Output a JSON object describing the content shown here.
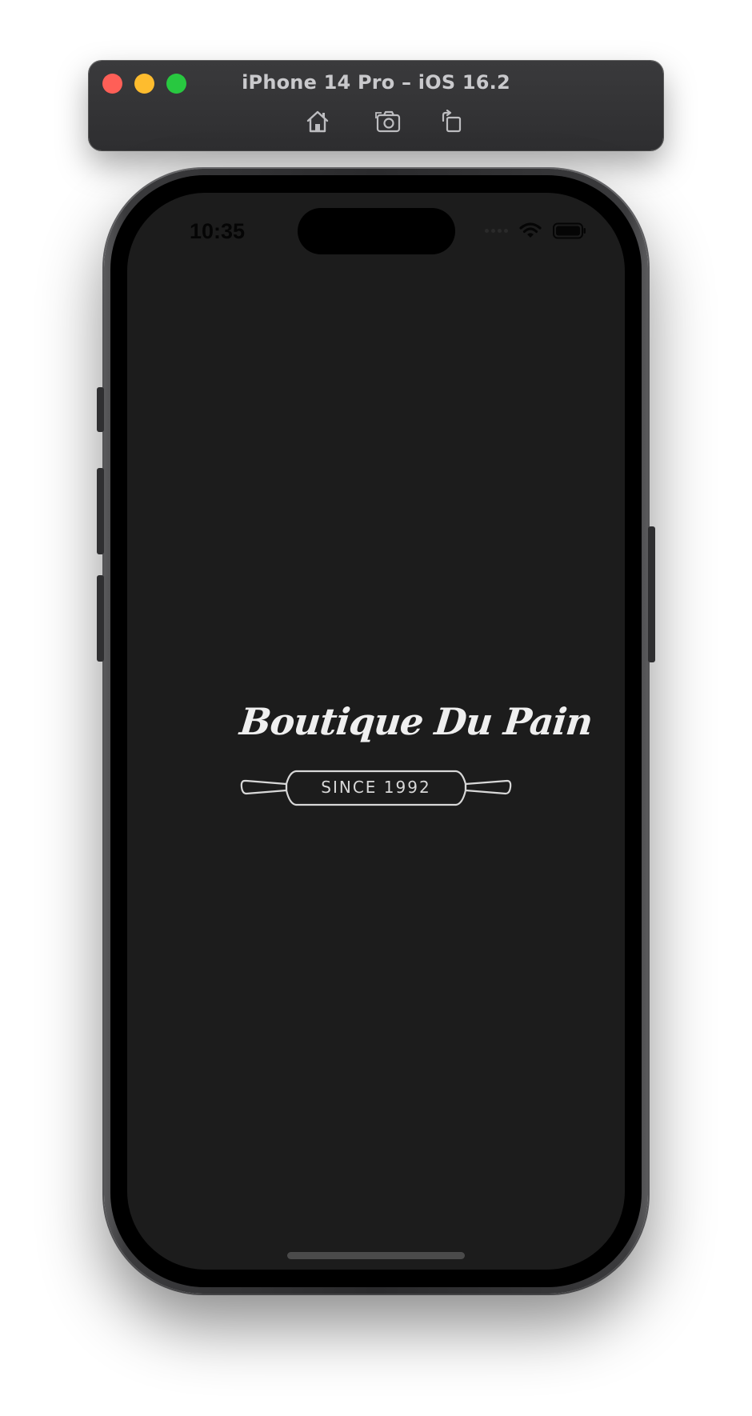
{
  "window": {
    "title": "iPhone 14 Pro – iOS 16.2",
    "toolbar": {
      "home_icon": "home-icon",
      "screenshot_icon": "camera-icon",
      "rotate_icon": "rotate-icon"
    },
    "traffic_lights": {
      "close_color": "#ff5f57",
      "minimize_color": "#febc2e",
      "zoom_color": "#28c840"
    }
  },
  "status_bar": {
    "time": "10:35",
    "icons": [
      "cellular-signal-icon",
      "wifi-icon",
      "battery-icon"
    ]
  },
  "splash": {
    "brand_name": "Boutique Du Pain",
    "tagline": "SINCE 1992",
    "background_color": "#1c1c1c",
    "logo_color": "#efefef"
  }
}
